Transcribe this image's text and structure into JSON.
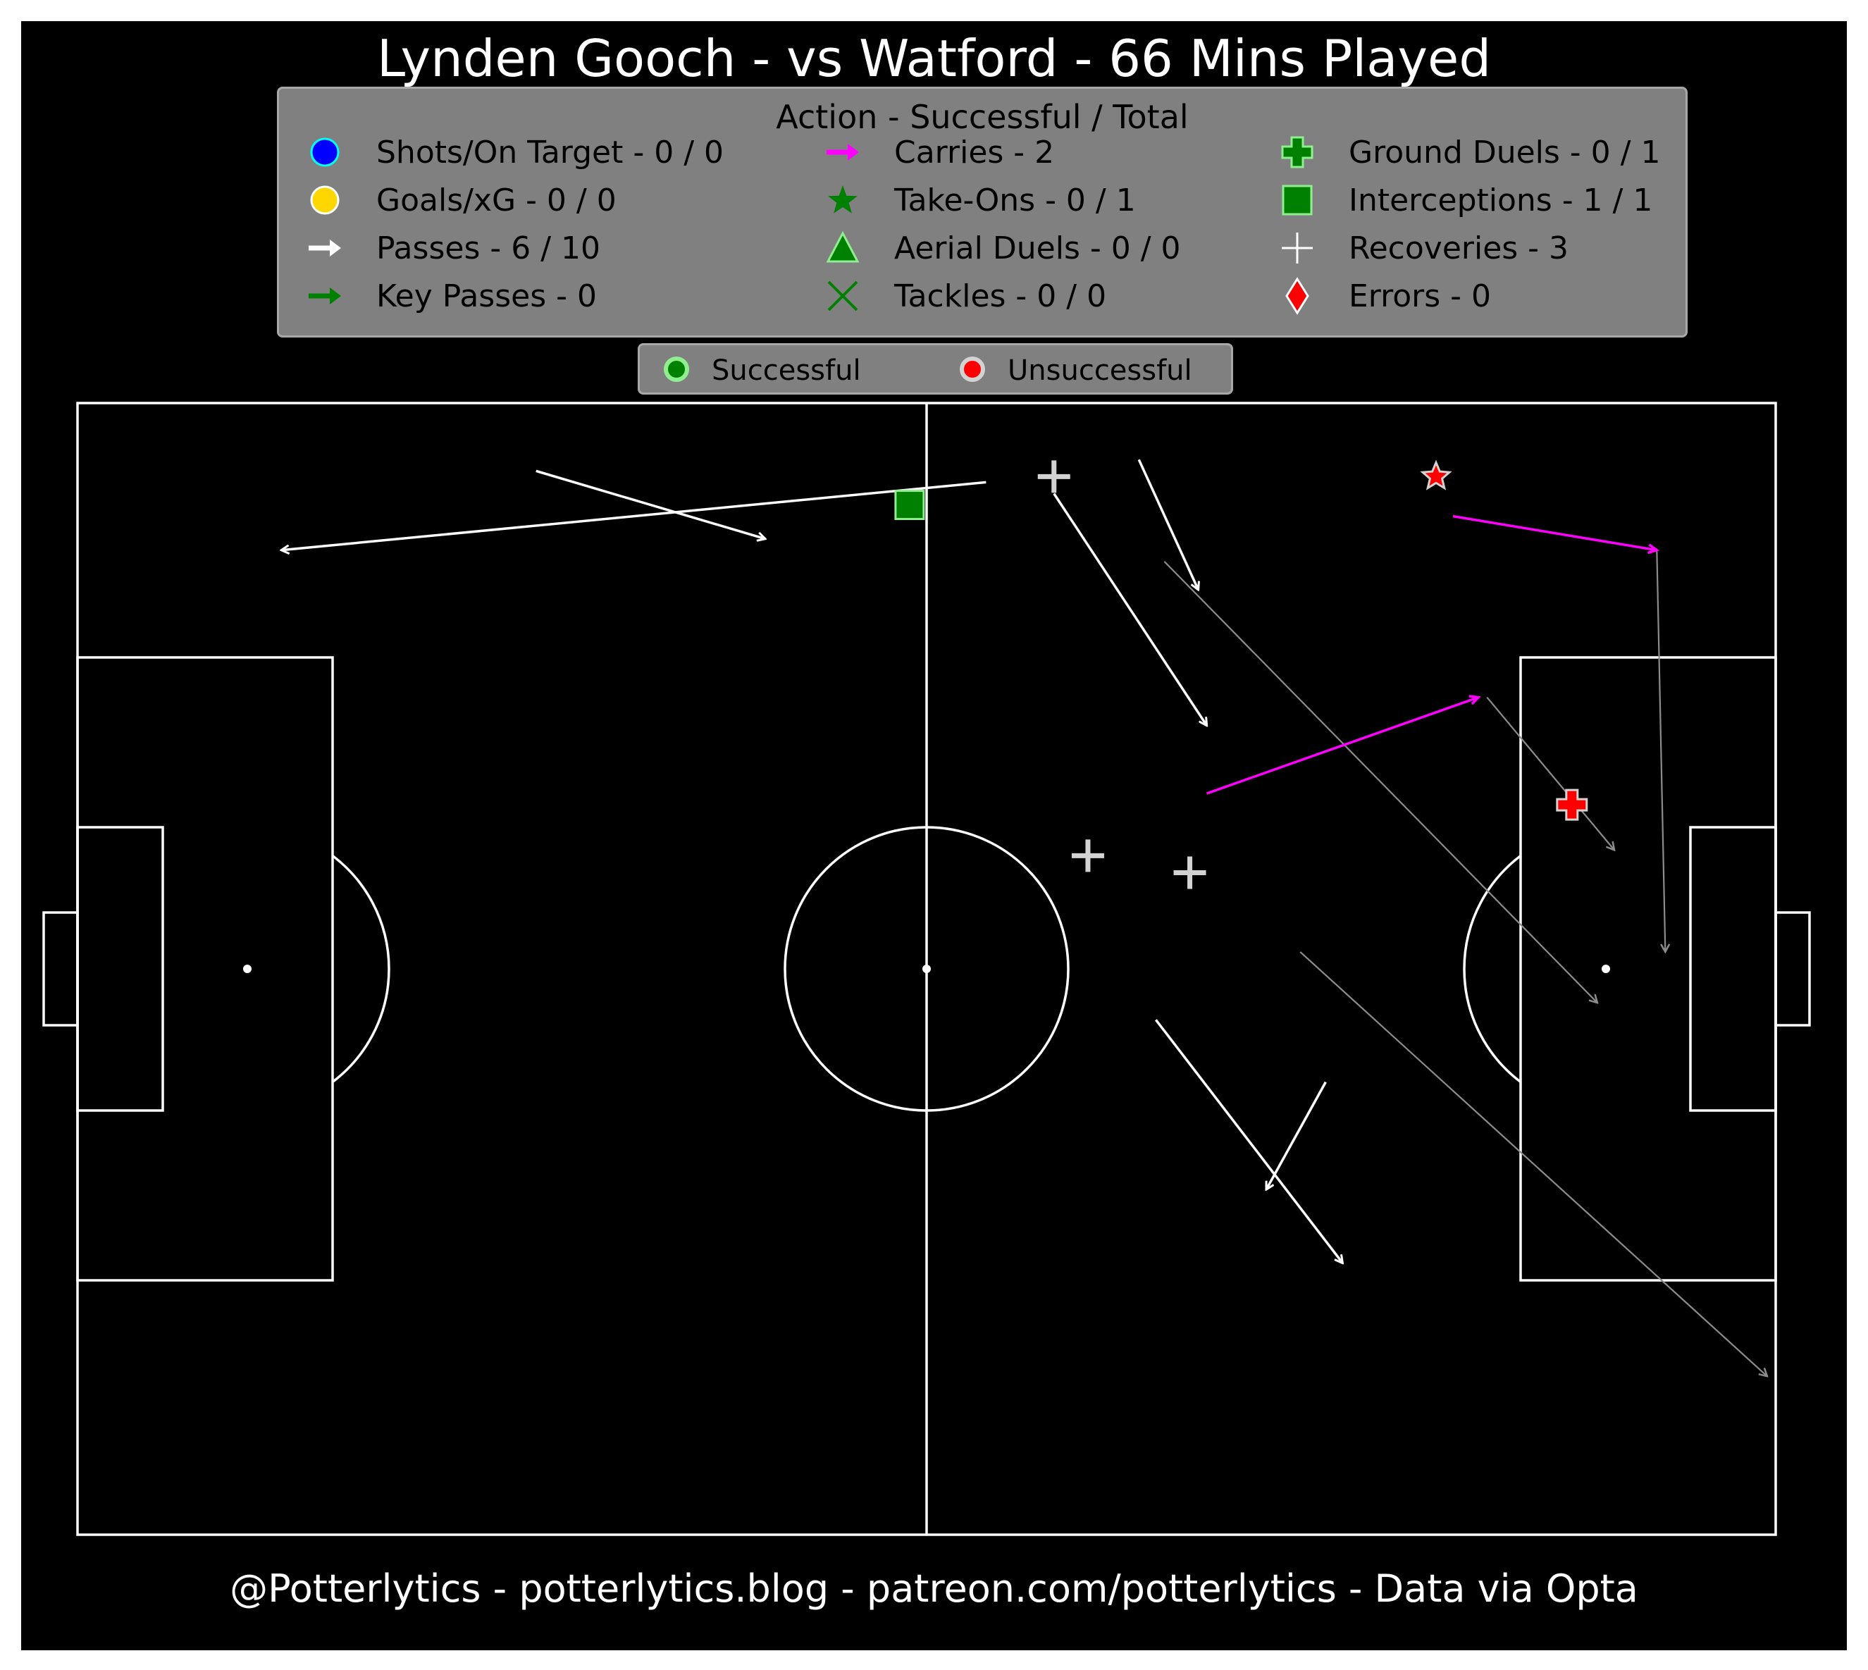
{
  "title": "Lynden Gooch - vs Watford - 66 Mins Played",
  "footer": "@Potterlytics - potterlytics.blog - patreon.com/potterlytics - Data via Opta",
  "legend": {
    "title": "Action - Successful / Total",
    "items": [
      {
        "label": "Shots/On Target - 0 / 0",
        "icon": "circle-icon",
        "color": "#0000ff",
        "edge": "#00ffff"
      },
      {
        "label": "Goals/xG - 0 / 0",
        "icon": "circle-icon",
        "color": "#ffd700",
        "edge": "#ffffff"
      },
      {
        "label": "Passes - 6 / 10",
        "icon": "arrow-icon",
        "color": "#ffffff"
      },
      {
        "label": "Key Passes - 0",
        "icon": "arrow-icon",
        "color": "#008000"
      },
      {
        "label": "Carries - 2",
        "icon": "arrow-icon",
        "color": "#ff00ff"
      },
      {
        "label": "Take-Ons - 0 / 1",
        "icon": "star-icon",
        "color": "#008000"
      },
      {
        "label": "Aerial Duels - 0 / 0",
        "icon": "triangle-icon",
        "color": "#008000",
        "edge": "#90ee90"
      },
      {
        "label": "Tackles - 0 / 0",
        "icon": "x-icon",
        "color": "#008000"
      },
      {
        "label": "Ground Duels - 0 / 1",
        "icon": "cross-icon",
        "color": "#008000",
        "edge": "#90ee90"
      },
      {
        "label": "Interceptions - 1 / 1",
        "icon": "square-icon",
        "color": "#008000",
        "edge": "#90ee90"
      },
      {
        "label": "Recoveries - 3",
        "icon": "plus-icon",
        "color": "#ffffff"
      },
      {
        "label": "Errors - 0",
        "icon": "diamond-icon",
        "color": "#ff0000",
        "edge": "#ffffff"
      }
    ]
  },
  "status_legend": {
    "successful": {
      "label": "Successful",
      "color": "#008000",
      "edge": "#90ee90"
    },
    "unsuccessful": {
      "label": "Unsuccessful",
      "color": "#ff0000",
      "edge": "#d3d3d3"
    }
  },
  "chart_data": {
    "type": "scatter",
    "pitch": {
      "length": 100,
      "width": 100
    },
    "passes_successful": [
      {
        "x": 53.5,
        "y": 93.0,
        "end_x": 12.0,
        "end_y": 87.0
      },
      {
        "x": 27.0,
        "y": 94.0,
        "end_x": 40.5,
        "end_y": 88.0
      },
      {
        "x": 62.5,
        "y": 95.0,
        "end_x": 66.0,
        "end_y": 83.5
      },
      {
        "x": 57.5,
        "y": 92.0,
        "end_x": 66.5,
        "end_y": 71.5
      },
      {
        "x": 63.5,
        "y": 45.5,
        "end_x": 74.5,
        "end_y": 24.0
      },
      {
        "x": 73.5,
        "y": 40.0,
        "end_x": 70.0,
        "end_y": 30.5
      }
    ],
    "passes_unsuccessful": [
      {
        "x": 64.0,
        "y": 86.0,
        "end_x": 89.5,
        "end_y": 47.0
      },
      {
        "x": 83.0,
        "y": 74.0,
        "end_x": 90.5,
        "end_y": 60.5
      },
      {
        "x": 93.0,
        "y": 87.0,
        "end_x": 93.5,
        "end_y": 51.5
      },
      {
        "x": 72.0,
        "y": 51.5,
        "end_x": 99.5,
        "end_y": 14.0
      }
    ],
    "carries": [
      {
        "x": 81.0,
        "y": 90.0,
        "end_x": 93.0,
        "end_y": 87.0
      },
      {
        "x": 66.5,
        "y": 65.5,
        "end_x": 82.5,
        "end_y": 74.0
      }
    ],
    "take_ons": [
      {
        "x": 80.0,
        "y": 93.5,
        "outcome": "unsuccessful"
      }
    ],
    "ground_duels": [
      {
        "x": 88.0,
        "y": 64.5,
        "outcome": "unsuccessful"
      }
    ],
    "interceptions": [
      {
        "x": 49.0,
        "y": 91.0,
        "outcome": "successful"
      }
    ],
    "recoveries": [
      {
        "x": 57.5,
        "y": 93.5
      },
      {
        "x": 59.5,
        "y": 60.0
      },
      {
        "x": 65.5,
        "y": 58.5
      }
    ],
    "shots": [],
    "goals": [],
    "key_passes": [],
    "aerial_duels": [],
    "tackles": [],
    "errors": []
  }
}
